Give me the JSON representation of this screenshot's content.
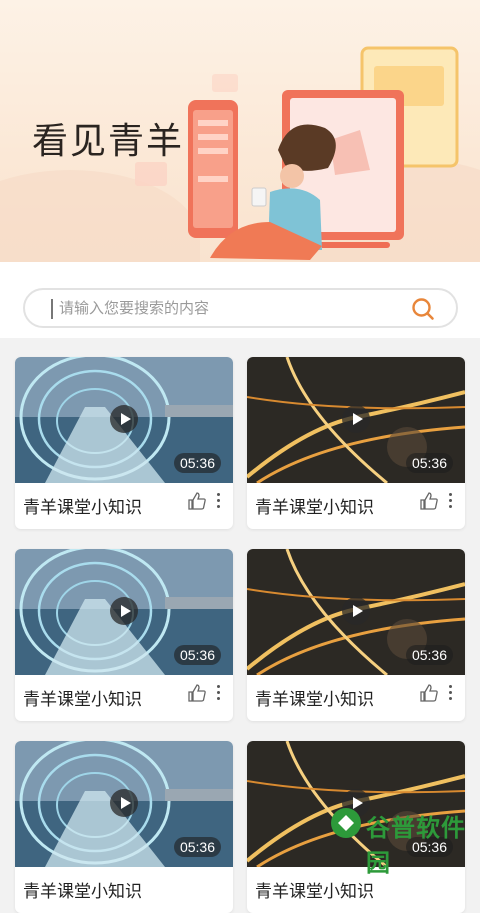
{
  "banner": {
    "title": "看见青羊"
  },
  "search": {
    "placeholder": "请输入您要搜索的内容"
  },
  "videos": [
    {
      "title": "青羊课堂小知识",
      "duration": "05:36",
      "scene": "tunnel"
    },
    {
      "title": "青羊课堂小知识",
      "duration": "05:36",
      "scene": "city"
    },
    {
      "title": "青羊课堂小知识",
      "duration": "05:36",
      "scene": "tunnel"
    },
    {
      "title": "青羊课堂小知识",
      "duration": "05:36",
      "scene": "city"
    },
    {
      "title": "青羊课堂小知识",
      "duration": "05:36",
      "scene": "tunnel"
    },
    {
      "title": "青羊课堂小知识",
      "duration": "05:36",
      "scene": "city"
    }
  ],
  "watermark": {
    "text": "谷普软件园"
  },
  "colors": {
    "accent": "#e8863a",
    "banner_bg": "#fbe8d6",
    "title_text": "#222222"
  }
}
